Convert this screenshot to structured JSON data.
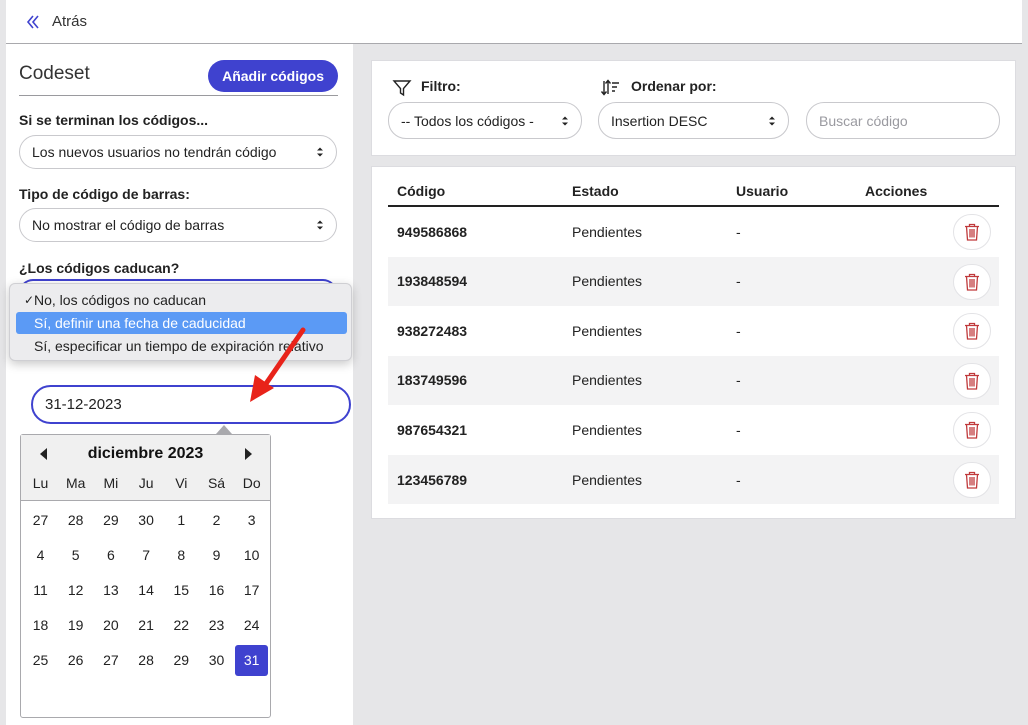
{
  "header": {
    "back_label": "Atrás"
  },
  "sidebar": {
    "title": "Codeset",
    "add_button": "Añadir códigos",
    "exhaust": {
      "label": "Si se terminan los códigos...",
      "value": "Los nuevos usuarios no tendrán código"
    },
    "barcode": {
      "label": "Tipo de código de barras:",
      "value": "No mostrar el código de barras"
    },
    "expiry": {
      "label": "¿Los códigos caducan?"
    },
    "expiry_options": [
      {
        "label": "No, los códigos no caducan",
        "check": "✓"
      },
      {
        "label": "Sí, definir una fecha de caducidad",
        "check": ""
      },
      {
        "label": "Sí, especificar un tiempo de expiración relativo",
        "check": ""
      }
    ],
    "date_value": "31-12-2023"
  },
  "calendar": {
    "title": "diciembre 2023",
    "weekdays": [
      "Lu",
      "Ma",
      "Mi",
      "Ju",
      "Vi",
      "Sá",
      "Do"
    ],
    "weeks": [
      [
        "27",
        "28",
        "29",
        "30",
        "1",
        "2",
        "3"
      ],
      [
        "4",
        "5",
        "6",
        "7",
        "8",
        "9",
        "10"
      ],
      [
        "11",
        "12",
        "13",
        "14",
        "15",
        "16",
        "17"
      ],
      [
        "18",
        "19",
        "20",
        "21",
        "22",
        "23",
        "24"
      ],
      [
        "25",
        "26",
        "27",
        "28",
        "29",
        "30",
        "31"
      ]
    ],
    "selected": "31"
  },
  "filters": {
    "filter_label": "Filtro:",
    "filter_value": "-- Todos los códigos -",
    "sort_label": "Ordenar por:",
    "sort_value": "Insertion DESC",
    "search_placeholder": "Buscar código"
  },
  "table": {
    "headers": [
      "Código",
      "Estado",
      "Usuario",
      "Acciones"
    ],
    "rows": [
      {
        "code": "949586868",
        "status": "Pendientes",
        "user": "-"
      },
      {
        "code": "193848594",
        "status": "Pendientes",
        "user": "-"
      },
      {
        "code": "938272483",
        "status": "Pendientes",
        "user": "-"
      },
      {
        "code": "183749596",
        "status": "Pendientes",
        "user": "-"
      },
      {
        "code": "987654321",
        "status": "Pendientes",
        "user": "-"
      },
      {
        "code": "123456789",
        "status": "Pendientes",
        "user": "-"
      }
    ]
  },
  "colors": {
    "accent": "#3f42cf",
    "highlight": "#5b9af5",
    "trash": "#c0393b",
    "annotation_arrow": "#e8231a"
  }
}
